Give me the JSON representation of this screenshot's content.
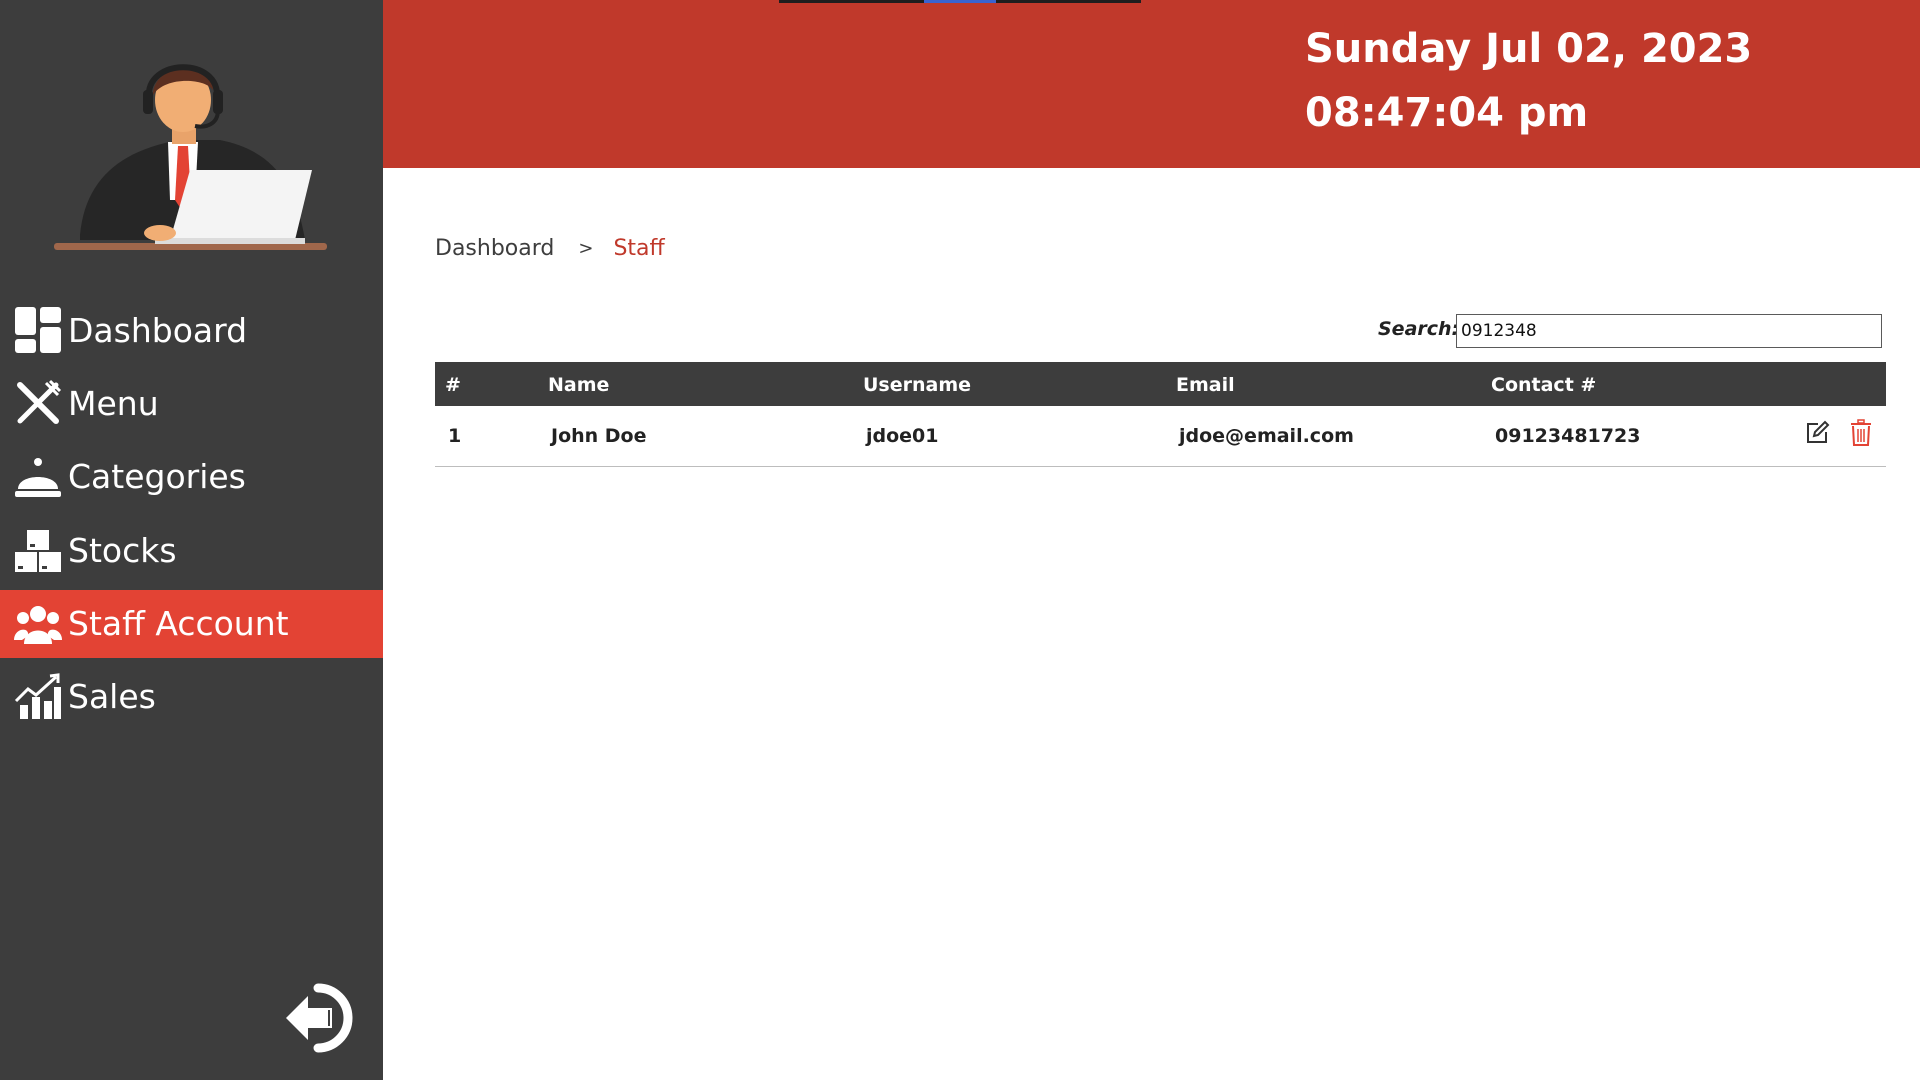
{
  "sidebar": {
    "items": [
      {
        "label": "Dashboard",
        "icon": "dashboard-icon"
      },
      {
        "label": "Menu",
        "icon": "utensils-icon"
      },
      {
        "label": "Categories",
        "icon": "cloche-icon"
      },
      {
        "label": "Stocks",
        "icon": "boxes-icon"
      },
      {
        "label": "Staff Account",
        "icon": "users-icon",
        "active": true
      },
      {
        "label": "Sales",
        "icon": "chart-icon"
      }
    ],
    "logout_icon": "logout-icon"
  },
  "header": {
    "date": "Sunday Jul 02, 2023",
    "time": "08:47:04 pm"
  },
  "breadcrumb": {
    "home": "Dashboard",
    "separator": ">",
    "current": "Staff"
  },
  "search": {
    "label": "Search:",
    "value": "0912348"
  },
  "table": {
    "headers": [
      "#",
      "Name",
      "Username",
      "Email",
      "Contact #"
    ],
    "rows": [
      {
        "num": "1",
        "name": "John Doe",
        "username": "jdoe01",
        "email": "jdoe@email.com",
        "contact": "09123481723"
      }
    ]
  },
  "colors": {
    "sidebar_bg": "#3d3d3d",
    "header_bg": "#c0392b",
    "active_item": "#e34334",
    "accent": "#c0392b"
  }
}
